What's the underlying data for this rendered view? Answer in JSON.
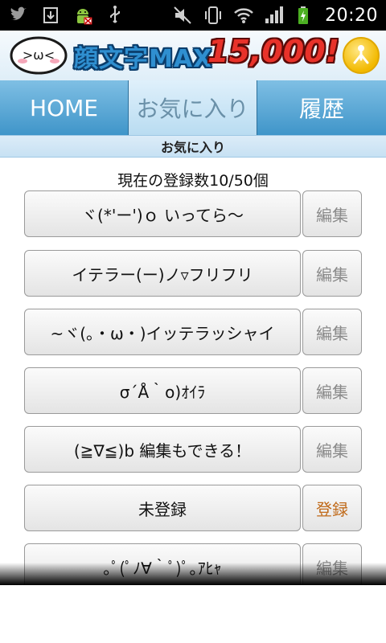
{
  "status_bar": {
    "time": "20:20",
    "icons_left": [
      "twitter-icon",
      "download-icon",
      "android-robot-icon",
      "usb-icon"
    ],
    "icons_right": [
      "mute-icon",
      "vibrate-icon",
      "wifi-icon",
      "signal-icon",
      "battery-icon"
    ]
  },
  "header": {
    "logo_text": "顔文字MAX",
    "logo_count": "15,000!",
    "mascot_face": ">ω<",
    "share_icon": "share-icon",
    "colors": {
      "logo_blue": "#2f8fd0",
      "logo_red": "#e8322a",
      "share_yellow": "#f2b900"
    }
  },
  "tabs": [
    {
      "label": "HOME"
    },
    {
      "label": "お気に入り",
      "active": true
    },
    {
      "label": "履歴"
    }
  ],
  "subtitle": "お気に入り",
  "count_text": "現在の登録数10/50個",
  "items": [
    {
      "kaomoji": "ヾ(*'ー')ｏ いってら〜",
      "action": "編集"
    },
    {
      "kaomoji": "イテラー(ー)ノ▿フリフリ",
      "action": "編集"
    },
    {
      "kaomoji": "~ヾ(。・ω・)イッテラッシャイ",
      "action": "編集"
    },
    {
      "kaomoji": "σ´Å｀o)ｵｲﾗ",
      "action": "編集"
    },
    {
      "kaomoji": "(≧∇≦)b 編集もできる！",
      "action": "編集"
    },
    {
      "kaomoji": "未登録",
      "action": "登録"
    },
    {
      "kaomoji": "｡ﾟ(ﾟﾉ∀｀ﾟ)ﾟ｡ｱﾋｬ",
      "action": "編集"
    }
  ]
}
